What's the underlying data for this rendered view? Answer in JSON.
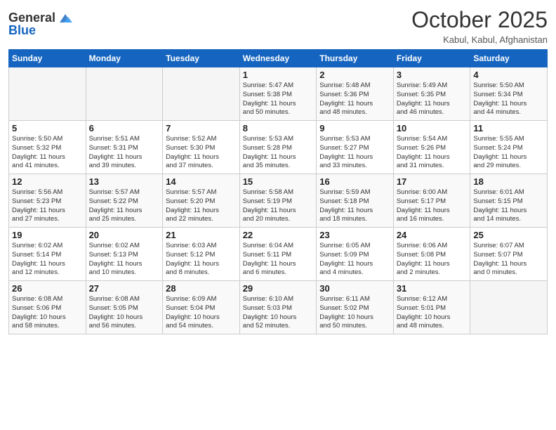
{
  "header": {
    "logo_general": "General",
    "logo_blue": "Blue",
    "month_title": "October 2025",
    "location": "Kabul, Kabul, Afghanistan"
  },
  "days_of_week": [
    "Sunday",
    "Monday",
    "Tuesday",
    "Wednesday",
    "Thursday",
    "Friday",
    "Saturday"
  ],
  "weeks": [
    [
      {
        "day": "",
        "info": ""
      },
      {
        "day": "",
        "info": ""
      },
      {
        "day": "",
        "info": ""
      },
      {
        "day": "1",
        "info": "Sunrise: 5:47 AM\nSunset: 5:38 PM\nDaylight: 11 hours\nand 50 minutes."
      },
      {
        "day": "2",
        "info": "Sunrise: 5:48 AM\nSunset: 5:36 PM\nDaylight: 11 hours\nand 48 minutes."
      },
      {
        "day": "3",
        "info": "Sunrise: 5:49 AM\nSunset: 5:35 PM\nDaylight: 11 hours\nand 46 minutes."
      },
      {
        "day": "4",
        "info": "Sunrise: 5:50 AM\nSunset: 5:34 PM\nDaylight: 11 hours\nand 44 minutes."
      }
    ],
    [
      {
        "day": "5",
        "info": "Sunrise: 5:50 AM\nSunset: 5:32 PM\nDaylight: 11 hours\nand 41 minutes."
      },
      {
        "day": "6",
        "info": "Sunrise: 5:51 AM\nSunset: 5:31 PM\nDaylight: 11 hours\nand 39 minutes."
      },
      {
        "day": "7",
        "info": "Sunrise: 5:52 AM\nSunset: 5:30 PM\nDaylight: 11 hours\nand 37 minutes."
      },
      {
        "day": "8",
        "info": "Sunrise: 5:53 AM\nSunset: 5:28 PM\nDaylight: 11 hours\nand 35 minutes."
      },
      {
        "day": "9",
        "info": "Sunrise: 5:53 AM\nSunset: 5:27 PM\nDaylight: 11 hours\nand 33 minutes."
      },
      {
        "day": "10",
        "info": "Sunrise: 5:54 AM\nSunset: 5:26 PM\nDaylight: 11 hours\nand 31 minutes."
      },
      {
        "day": "11",
        "info": "Sunrise: 5:55 AM\nSunset: 5:24 PM\nDaylight: 11 hours\nand 29 minutes."
      }
    ],
    [
      {
        "day": "12",
        "info": "Sunrise: 5:56 AM\nSunset: 5:23 PM\nDaylight: 11 hours\nand 27 minutes."
      },
      {
        "day": "13",
        "info": "Sunrise: 5:57 AM\nSunset: 5:22 PM\nDaylight: 11 hours\nand 25 minutes."
      },
      {
        "day": "14",
        "info": "Sunrise: 5:57 AM\nSunset: 5:20 PM\nDaylight: 11 hours\nand 22 minutes."
      },
      {
        "day": "15",
        "info": "Sunrise: 5:58 AM\nSunset: 5:19 PM\nDaylight: 11 hours\nand 20 minutes."
      },
      {
        "day": "16",
        "info": "Sunrise: 5:59 AM\nSunset: 5:18 PM\nDaylight: 11 hours\nand 18 minutes."
      },
      {
        "day": "17",
        "info": "Sunrise: 6:00 AM\nSunset: 5:17 PM\nDaylight: 11 hours\nand 16 minutes."
      },
      {
        "day": "18",
        "info": "Sunrise: 6:01 AM\nSunset: 5:15 PM\nDaylight: 11 hours\nand 14 minutes."
      }
    ],
    [
      {
        "day": "19",
        "info": "Sunrise: 6:02 AM\nSunset: 5:14 PM\nDaylight: 11 hours\nand 12 minutes."
      },
      {
        "day": "20",
        "info": "Sunrise: 6:02 AM\nSunset: 5:13 PM\nDaylight: 11 hours\nand 10 minutes."
      },
      {
        "day": "21",
        "info": "Sunrise: 6:03 AM\nSunset: 5:12 PM\nDaylight: 11 hours\nand 8 minutes."
      },
      {
        "day": "22",
        "info": "Sunrise: 6:04 AM\nSunset: 5:11 PM\nDaylight: 11 hours\nand 6 minutes."
      },
      {
        "day": "23",
        "info": "Sunrise: 6:05 AM\nSunset: 5:09 PM\nDaylight: 11 hours\nand 4 minutes."
      },
      {
        "day": "24",
        "info": "Sunrise: 6:06 AM\nSunset: 5:08 PM\nDaylight: 11 hours\nand 2 minutes."
      },
      {
        "day": "25",
        "info": "Sunrise: 6:07 AM\nSunset: 5:07 PM\nDaylight: 11 hours\nand 0 minutes."
      }
    ],
    [
      {
        "day": "26",
        "info": "Sunrise: 6:08 AM\nSunset: 5:06 PM\nDaylight: 10 hours\nand 58 minutes."
      },
      {
        "day": "27",
        "info": "Sunrise: 6:08 AM\nSunset: 5:05 PM\nDaylight: 10 hours\nand 56 minutes."
      },
      {
        "day": "28",
        "info": "Sunrise: 6:09 AM\nSunset: 5:04 PM\nDaylight: 10 hours\nand 54 minutes."
      },
      {
        "day": "29",
        "info": "Sunrise: 6:10 AM\nSunset: 5:03 PM\nDaylight: 10 hours\nand 52 minutes."
      },
      {
        "day": "30",
        "info": "Sunrise: 6:11 AM\nSunset: 5:02 PM\nDaylight: 10 hours\nand 50 minutes."
      },
      {
        "day": "31",
        "info": "Sunrise: 6:12 AM\nSunset: 5:01 PM\nDaylight: 10 hours\nand 48 minutes."
      },
      {
        "day": "",
        "info": ""
      }
    ]
  ]
}
